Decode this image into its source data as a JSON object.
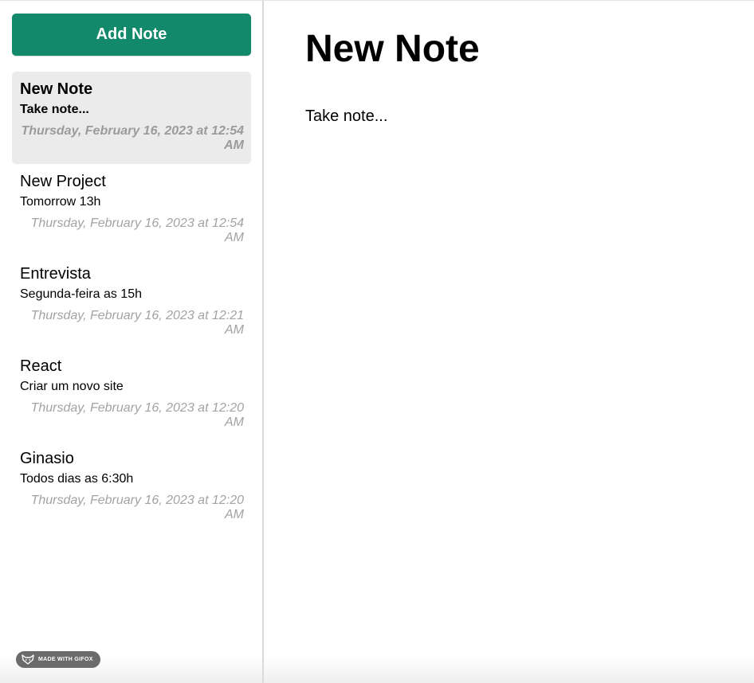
{
  "sidebar": {
    "add_button_label": "Add Note",
    "notes": [
      {
        "title": "New Note",
        "body": "Take note...",
        "date": "Thursday, February 16, 2023 at 12:54 AM",
        "active": true
      },
      {
        "title": "New Project",
        "body": "Tomorrow 13h",
        "date": "Thursday, February 16, 2023 at 12:54 AM",
        "active": false
      },
      {
        "title": "Entrevista",
        "body": "Segunda-feira as 15h",
        "date": "Thursday, February 16, 2023 at 12:21 AM",
        "active": false
      },
      {
        "title": "React",
        "body": "Criar um novo site",
        "date": "Thursday, February 16, 2023 at 12:20 AM",
        "active": false
      },
      {
        "title": "Ginasio",
        "body": "Todos dias as 6:30h",
        "date": "Thursday, February 16, 2023 at 12:20 AM",
        "active": false
      }
    ]
  },
  "main": {
    "title": "New Note",
    "body": "Take note..."
  },
  "badge": {
    "label": "MADE WITH GIFOX",
    "icon": "fox-icon"
  },
  "colors": {
    "accent": "#12896b",
    "active_note_bg": "#ebebeb",
    "date_text": "#a3a3a3",
    "badge_bg": "#6b6b6b"
  }
}
